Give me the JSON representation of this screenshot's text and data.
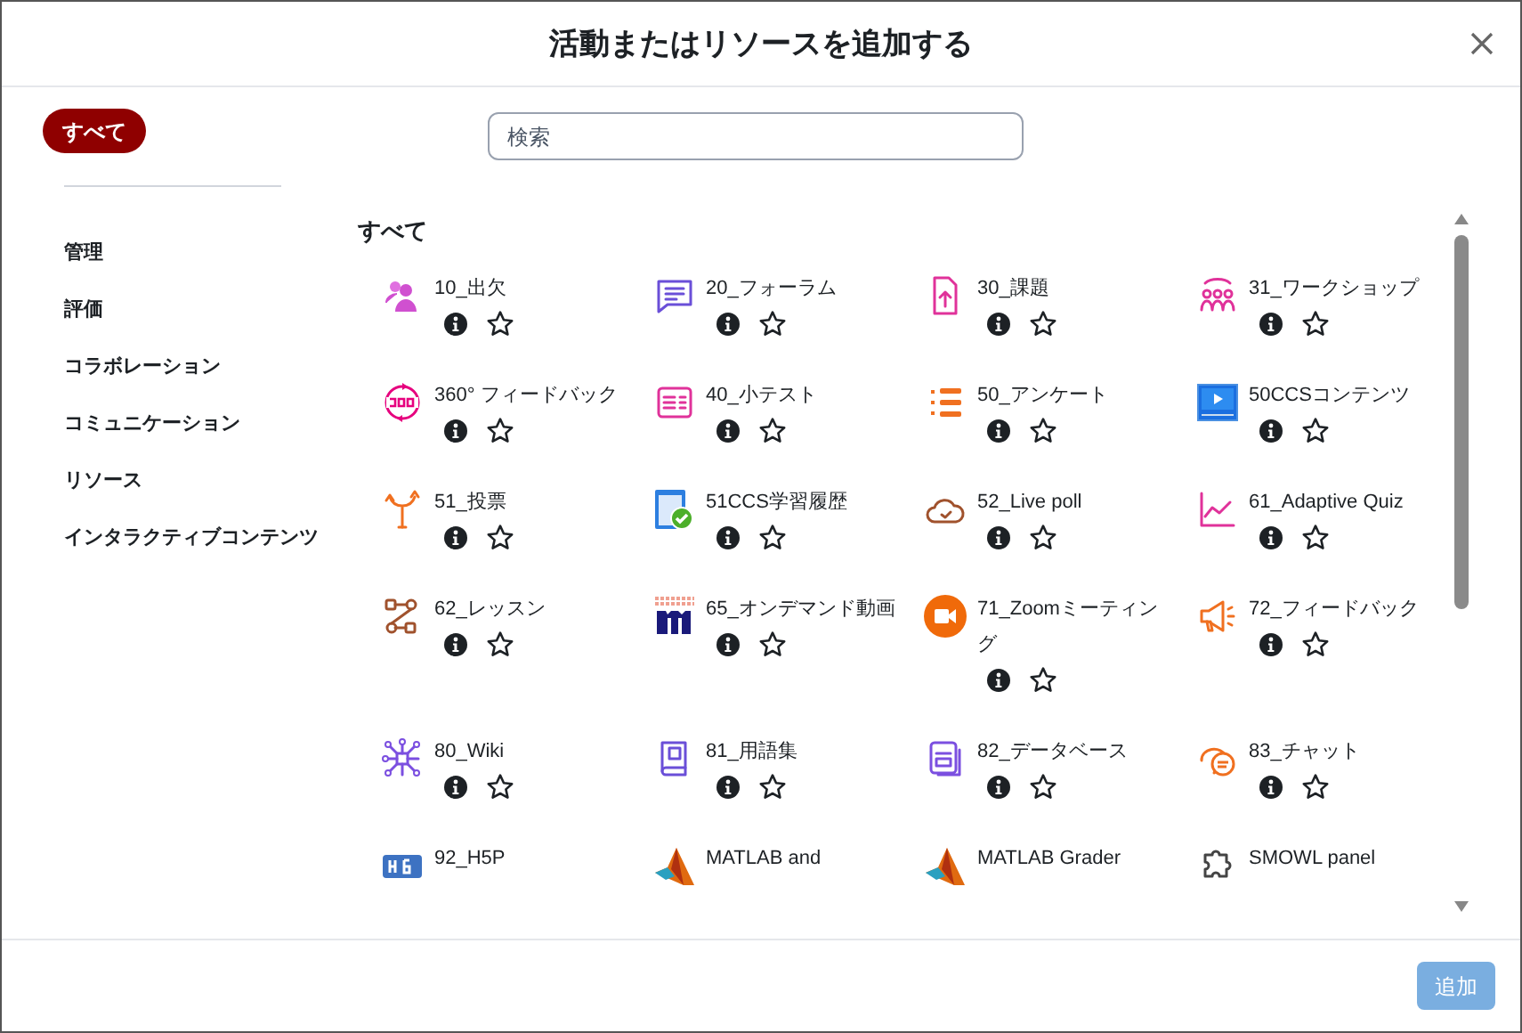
{
  "dialog": {
    "title": "活動またはリソースを追加する"
  },
  "nav": [
    {
      "label": "すべて",
      "selected": true
    },
    {
      "label": "管理",
      "selected": false
    },
    {
      "label": "評価",
      "selected": false
    },
    {
      "label": "コラボレーション",
      "selected": false
    },
    {
      "label": "コミュニケーション",
      "selected": false
    },
    {
      "label": "リソース",
      "selected": false
    },
    {
      "label": "インタラクティブコンテンツ",
      "selected": false
    }
  ],
  "search": {
    "placeholder": "検索"
  },
  "section_title": "すべて",
  "items": [
    {
      "name": "10_出欠",
      "starred": false
    },
    {
      "name": "20_フォーラム",
      "starred": false
    },
    {
      "name": "30_課題",
      "starred": false
    },
    {
      "name": "31_ワークショップ",
      "starred": false
    },
    {
      "name": "360° フィードバック",
      "starred": false
    },
    {
      "name": "40_小テスト",
      "starred": false
    },
    {
      "name": "50_アンケート",
      "starred": false
    },
    {
      "name": "50CCSコンテンツ",
      "starred": false
    },
    {
      "name": "51_投票",
      "starred": false
    },
    {
      "name": "51CCS学習履歴",
      "starred": false
    },
    {
      "name": "52_Live poll",
      "starred": false
    },
    {
      "name": "61_Adaptive Quiz",
      "starred": false
    },
    {
      "name": "62_レッスン",
      "starred": false
    },
    {
      "name": "65_オンデマンド動画",
      "starred": false
    },
    {
      "name": "71_Zoomミーティング",
      "starred": false
    },
    {
      "name": "72_フィードバック",
      "starred": false
    },
    {
      "name": "80_Wiki",
      "starred": false
    },
    {
      "name": "81_用語集",
      "starred": false
    },
    {
      "name": "82_データベース",
      "starred": false
    },
    {
      "name": "83_チャット",
      "starred": false
    },
    {
      "name": "92_H5P"
    },
    {
      "name": "MATLAB and"
    },
    {
      "name": "MATLAB Grader"
    },
    {
      "name": "SMOWL panel"
    }
  ],
  "footer": {
    "add_button": "追加"
  }
}
